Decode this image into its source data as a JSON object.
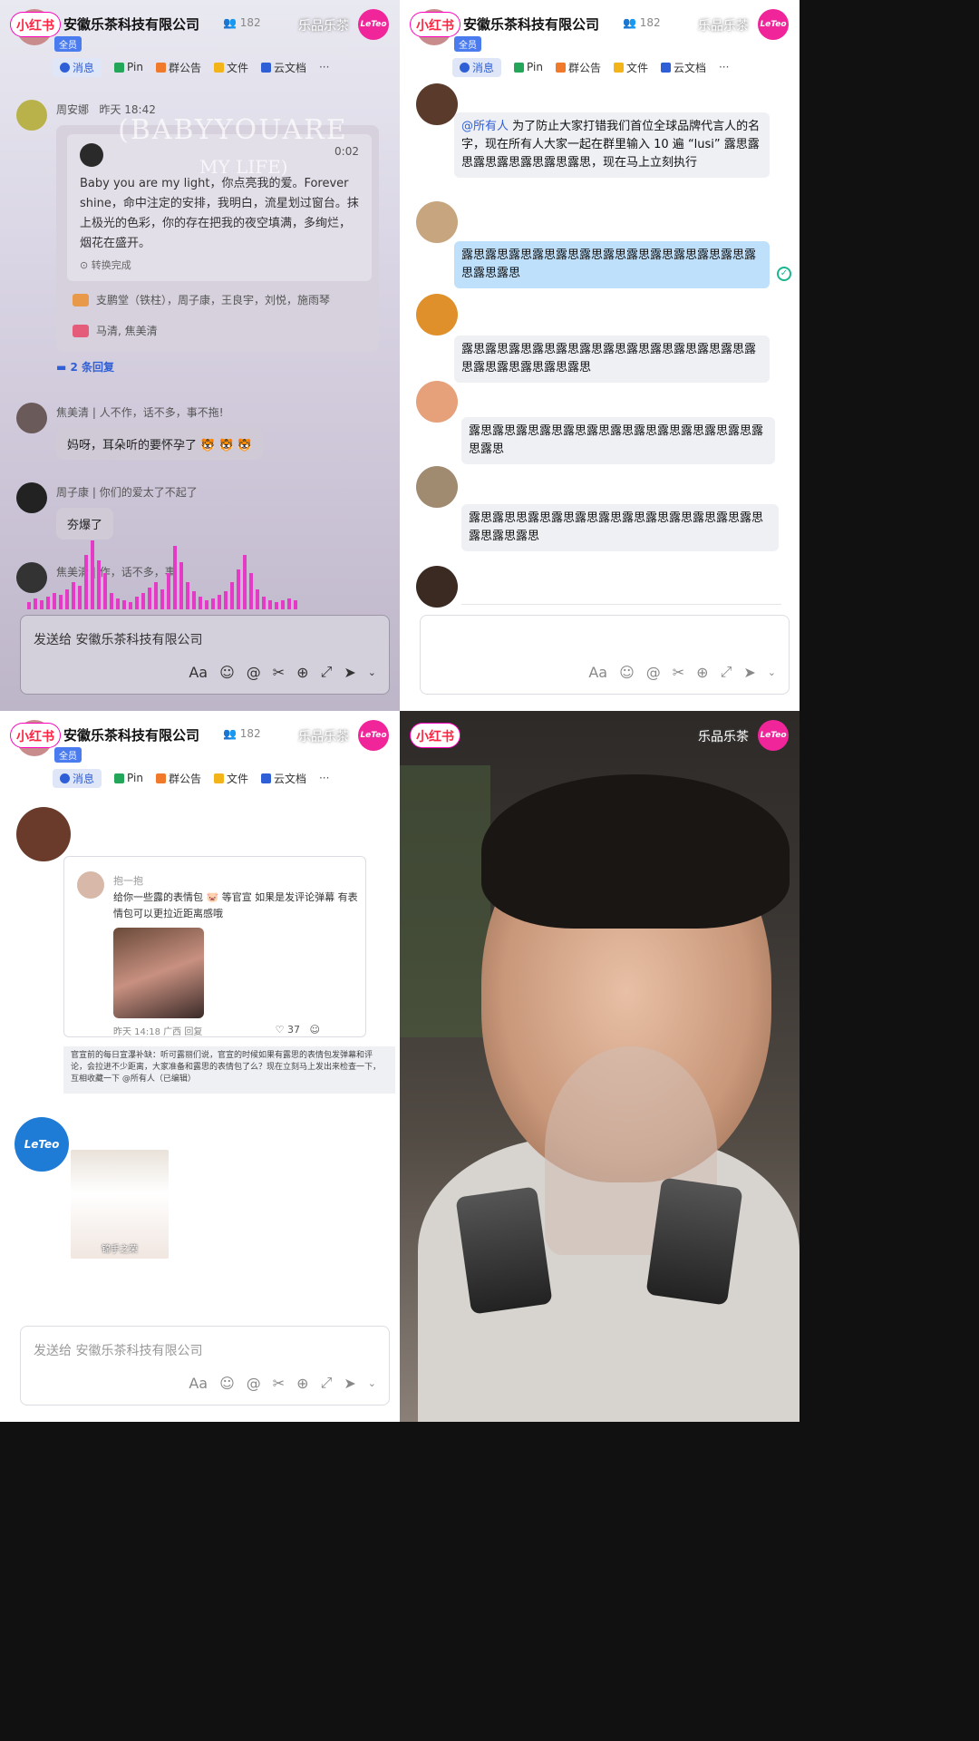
{
  "common": {
    "xhs_logo": "小红书",
    "group_title": "安徽乐茶科技有限公司",
    "member_count": "182",
    "brand": "乐品乐茶",
    "leteo": "LeTeo",
    "all_badge": "全员",
    "tabs": [
      "消息",
      "Pin",
      "群公告",
      "文件",
      "云文档"
    ],
    "more": "···",
    "composer_placeholder": "发送给 安徽乐茶科技有限公司",
    "tool_font": "Aa"
  },
  "panel1": {
    "sender": "周安娜",
    "sender_time": "昨天 18:42",
    "overlay_title": "(BABYYOUARE",
    "overlay_sub": "MY LIFE)",
    "voice_time": "0:02",
    "voice_text": "Baby you are my light，你点亮我的爱。Forever shine，命中注定的安排，我明白，流星划过窗台。抹上极光的色彩，你的存在把我的夜空填满，多绚烂，烟花在盛开。",
    "converted": "转换完成",
    "react1": "支鹏堂（铁柱），周子康，王良宇，刘悦，施雨琴",
    "react2": "马清, 焦美清",
    "replies": "2 条回复",
    "m2_name": "焦美清",
    "m2_status": "人不作，话不多，事不拖!",
    "m2_text": "妈呀，耳朵听的要怀孕了 🐯 🐯 🐯",
    "m3_name": "周子康",
    "m3_status": "你们的爱太了不起了",
    "m3_text": "夯爆了",
    "m4_name": "焦美清",
    "m4_status": "作，话不多，事",
    "wave": [
      8,
      12,
      10,
      14,
      18,
      16,
      22,
      30,
      26,
      60,
      76,
      54,
      40,
      18,
      12,
      10,
      8,
      14,
      18,
      24,
      30,
      22,
      40,
      70,
      52,
      30,
      20,
      14,
      10,
      12,
      16,
      20,
      30,
      44,
      60,
      40,
      22,
      14,
      10,
      8,
      10,
      12,
      10
    ]
  },
  "panel2": {
    "mention": "@所有人",
    "m1_text": " 为了防止大家打错我们首位全球品牌代言人的名字，现在所有人大家一起在群里输入 10 遍 “lusi” 露思露思露思露思露思露思露思，现在马上立刻执行",
    "m2_text": "露思露思露思露思露思露思露思露思露思露思露思露思露思露思露思",
    "m3_text": "露思露思露思露思露思露思露思露思露思露思露思露思露思露思露思露思露思露思",
    "m4_text": "露思露思露思露思露思露思露思露思露思露思露思露思露思露思",
    "m5_text": "露思露思思露思露思露思露思露思露思露思露思露思露思露思露思露思"
  },
  "panel3": {
    "sc_name": "抱一抱",
    "sc_text": "给你一些露的表情包 🐷 等官宣 如果是发评论弹幕 有表情包可以更拉近距离感哦",
    "sc_meta": "昨天 14:18 广西  回复",
    "sc_likes": "37",
    "quote": "官宣前的每日宣瀑补缺：听可露丽们说，官宣的时候如果有露思的表情包发弹幕和评论，会拉进不少距离，大家准备和露思的表情包了么？现在立刻马上发出来检查一下，互相收藏一下 @所有人（已编辑）",
    "sticker_label": "锦手之荣"
  }
}
